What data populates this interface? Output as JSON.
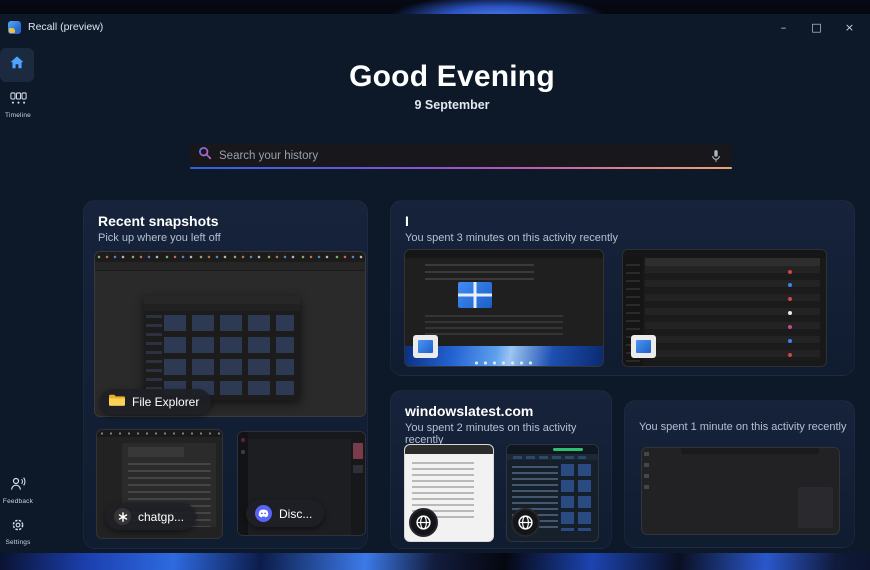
{
  "window": {
    "title": "Recall (preview)",
    "controls": {
      "minimize": "–",
      "maximize": "□",
      "close": "×"
    }
  },
  "sidebar": {
    "timeline_label": "Timeline",
    "feedback_label": "Feedback",
    "settings_label": "Settings"
  },
  "greeting": {
    "title": "Good Evening",
    "date": "9 September"
  },
  "search": {
    "placeholder": "Search your history"
  },
  "cards": {
    "recent_snapshots": {
      "title": "Recent snapshots",
      "subtitle": "Pick up where you left off",
      "snapshots": [
        {
          "label": "File Explorer",
          "icon": "folder-icon"
        },
        {
          "label": "chatgp...",
          "icon": "chatgpt-icon"
        },
        {
          "label": "Disc...",
          "icon": "discord-icon"
        }
      ]
    },
    "activity_top": {
      "title": "I",
      "subtitle": "You spent 3 minutes on this activity recently"
    },
    "windowslatest": {
      "title": "windowslatest.com",
      "subtitle": "You spent 2 minutes on this activity recently"
    },
    "activity_bottom": {
      "subtitle": "You spent 1 minute on this activity recently"
    }
  },
  "colors": {
    "window_bg": "#0d1828",
    "card_bg": "#14213500",
    "home_accent": "#4da3ff",
    "search_underline_start": "#2d64de",
    "search_underline_mid": "#8c54cc",
    "search_underline_end": "#e8a76e",
    "folder_yellow": "#f6c234",
    "discord_blurple": "#5865f2"
  }
}
